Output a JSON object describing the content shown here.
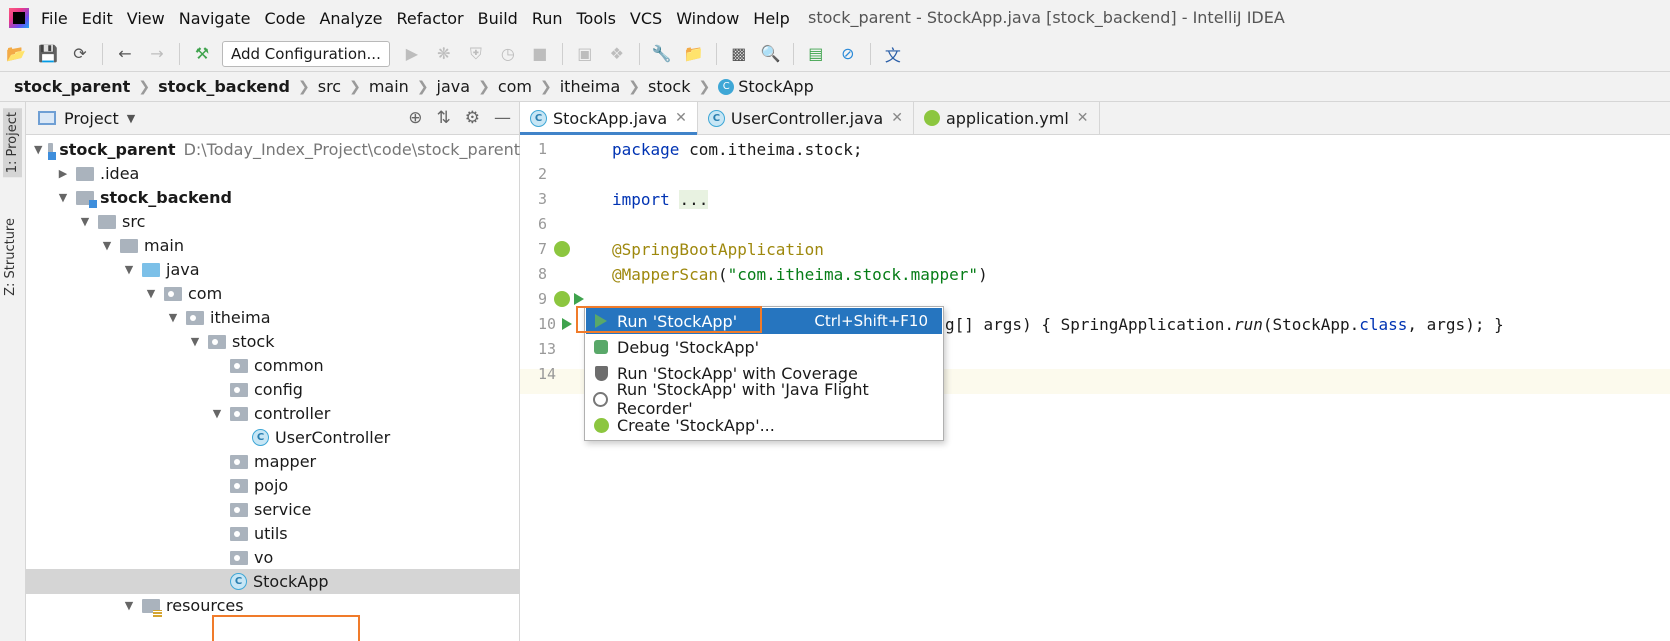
{
  "menubar": {
    "items": [
      "File",
      "Edit",
      "View",
      "Navigate",
      "Code",
      "Analyze",
      "Refactor",
      "Build",
      "Run",
      "Tools",
      "VCS",
      "Window",
      "Help"
    ],
    "window_title": "stock_parent - StockApp.java [stock_backend] - IntelliJ IDEA"
  },
  "toolbar": {
    "add_configuration": "Add Configuration..."
  },
  "breadcrumb": [
    "stock_parent",
    "stock_backend",
    "src",
    "main",
    "java",
    "com",
    "itheima",
    "stock",
    "StockApp"
  ],
  "left_stripe": {
    "project_tab": "1: Project",
    "structure_tab": "Z: Structure"
  },
  "project_panel": {
    "title": "Project",
    "tree": [
      {
        "label": "stock_parent",
        "hint": "D:\\Today_Index_Project\\code\\stock_parent"
      },
      {
        "label": ".idea"
      },
      {
        "label": "stock_backend"
      },
      {
        "label": "src"
      },
      {
        "label": "main"
      },
      {
        "label": "java"
      },
      {
        "label": "com"
      },
      {
        "label": "itheima"
      },
      {
        "label": "stock"
      },
      {
        "label": "common"
      },
      {
        "label": "config"
      },
      {
        "label": "controller"
      },
      {
        "label": "UserController"
      },
      {
        "label": "mapper"
      },
      {
        "label": "pojo"
      },
      {
        "label": "service"
      },
      {
        "label": "utils"
      },
      {
        "label": "vo"
      },
      {
        "label": "StockApp"
      },
      {
        "label": "resources"
      }
    ]
  },
  "editor": {
    "tabs": [
      {
        "label": "StockApp.java"
      },
      {
        "label": "UserController.java"
      },
      {
        "label": "application.yml"
      }
    ],
    "line_numbers": [
      "1",
      "2",
      "3",
      "6",
      "7",
      "8",
      "9",
      "10",
      "13",
      "14"
    ],
    "code": {
      "l1_kw": "package",
      "l1_rest": " com.itheima.stock;",
      "l3_kw": "import",
      "l3_fold": "...",
      "l7": "@SpringBootApplication",
      "l8_ann": "@MapperScan",
      "l8_open": "(",
      "l8_str": "\"com.itheima.stock.mapper\"",
      "l8_close": ")",
      "l10_a": "g[] args) { SpringApplication.",
      "l10_run": "run",
      "l10_b": "(StockApp.",
      "l10_class": "class",
      "l10_c": ", args); }"
    }
  },
  "popup": {
    "items": [
      {
        "label": "Run 'StockApp'",
        "shortcut": "Ctrl+Shift+F10"
      },
      {
        "label": "Debug 'StockApp'"
      },
      {
        "label": "Run 'StockApp' with Coverage"
      },
      {
        "label": "Run 'StockApp' with 'Java Flight Recorder'"
      },
      {
        "label": "Create 'StockApp'..."
      }
    ]
  },
  "colors": {
    "accent": "#2675bf",
    "highlight": "#f07b2a"
  }
}
